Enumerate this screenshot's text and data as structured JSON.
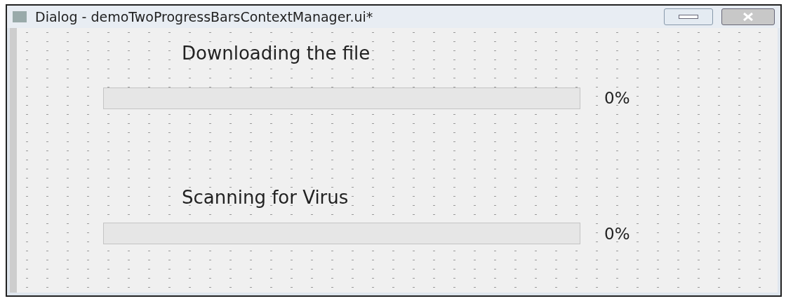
{
  "window": {
    "title": "Dialog - demoTwoProgressBarsContextManager.ui*"
  },
  "tasks": [
    {
      "label": "Downloading the file",
      "level": 0,
      "reading": "0%"
    },
    {
      "label": "Scanning for Virus",
      "level": 0,
      "reading": "0%"
    }
  ]
}
